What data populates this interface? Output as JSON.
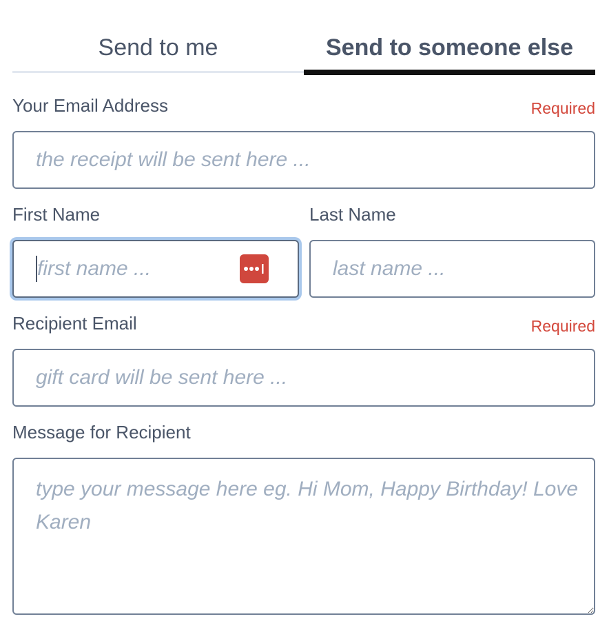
{
  "tabs": {
    "send_to_me": "Send to me",
    "send_to_someone_else": "Send to someone else",
    "active": "send_to_someone_else"
  },
  "your_email": {
    "label": "Your Email Address",
    "required": "Required",
    "placeholder": "the receipt will be sent here ...",
    "value": ""
  },
  "first_name": {
    "label": "First Name",
    "placeholder": "first name ...",
    "value": "",
    "focused": true,
    "autofill_icon": "password-manager-icon"
  },
  "last_name": {
    "label": "Last Name",
    "placeholder": "last name ...",
    "value": ""
  },
  "recipient_email": {
    "label": "Recipient Email",
    "required": "Required",
    "placeholder": "gift card will be sent here ...",
    "value": ""
  },
  "message": {
    "label": "Message for Recipient",
    "placeholder": "type your message here eg. Hi Mom, Happy Birthday! Love Karen",
    "value": ""
  },
  "colors": {
    "required": "#d3473b",
    "text": "#4a5568",
    "placeholder": "#a0aec0",
    "border": "#718096",
    "focus_ring": "#a9c8ec",
    "password_icon": "#d0473d",
    "active_tab_underline": "#111111"
  }
}
